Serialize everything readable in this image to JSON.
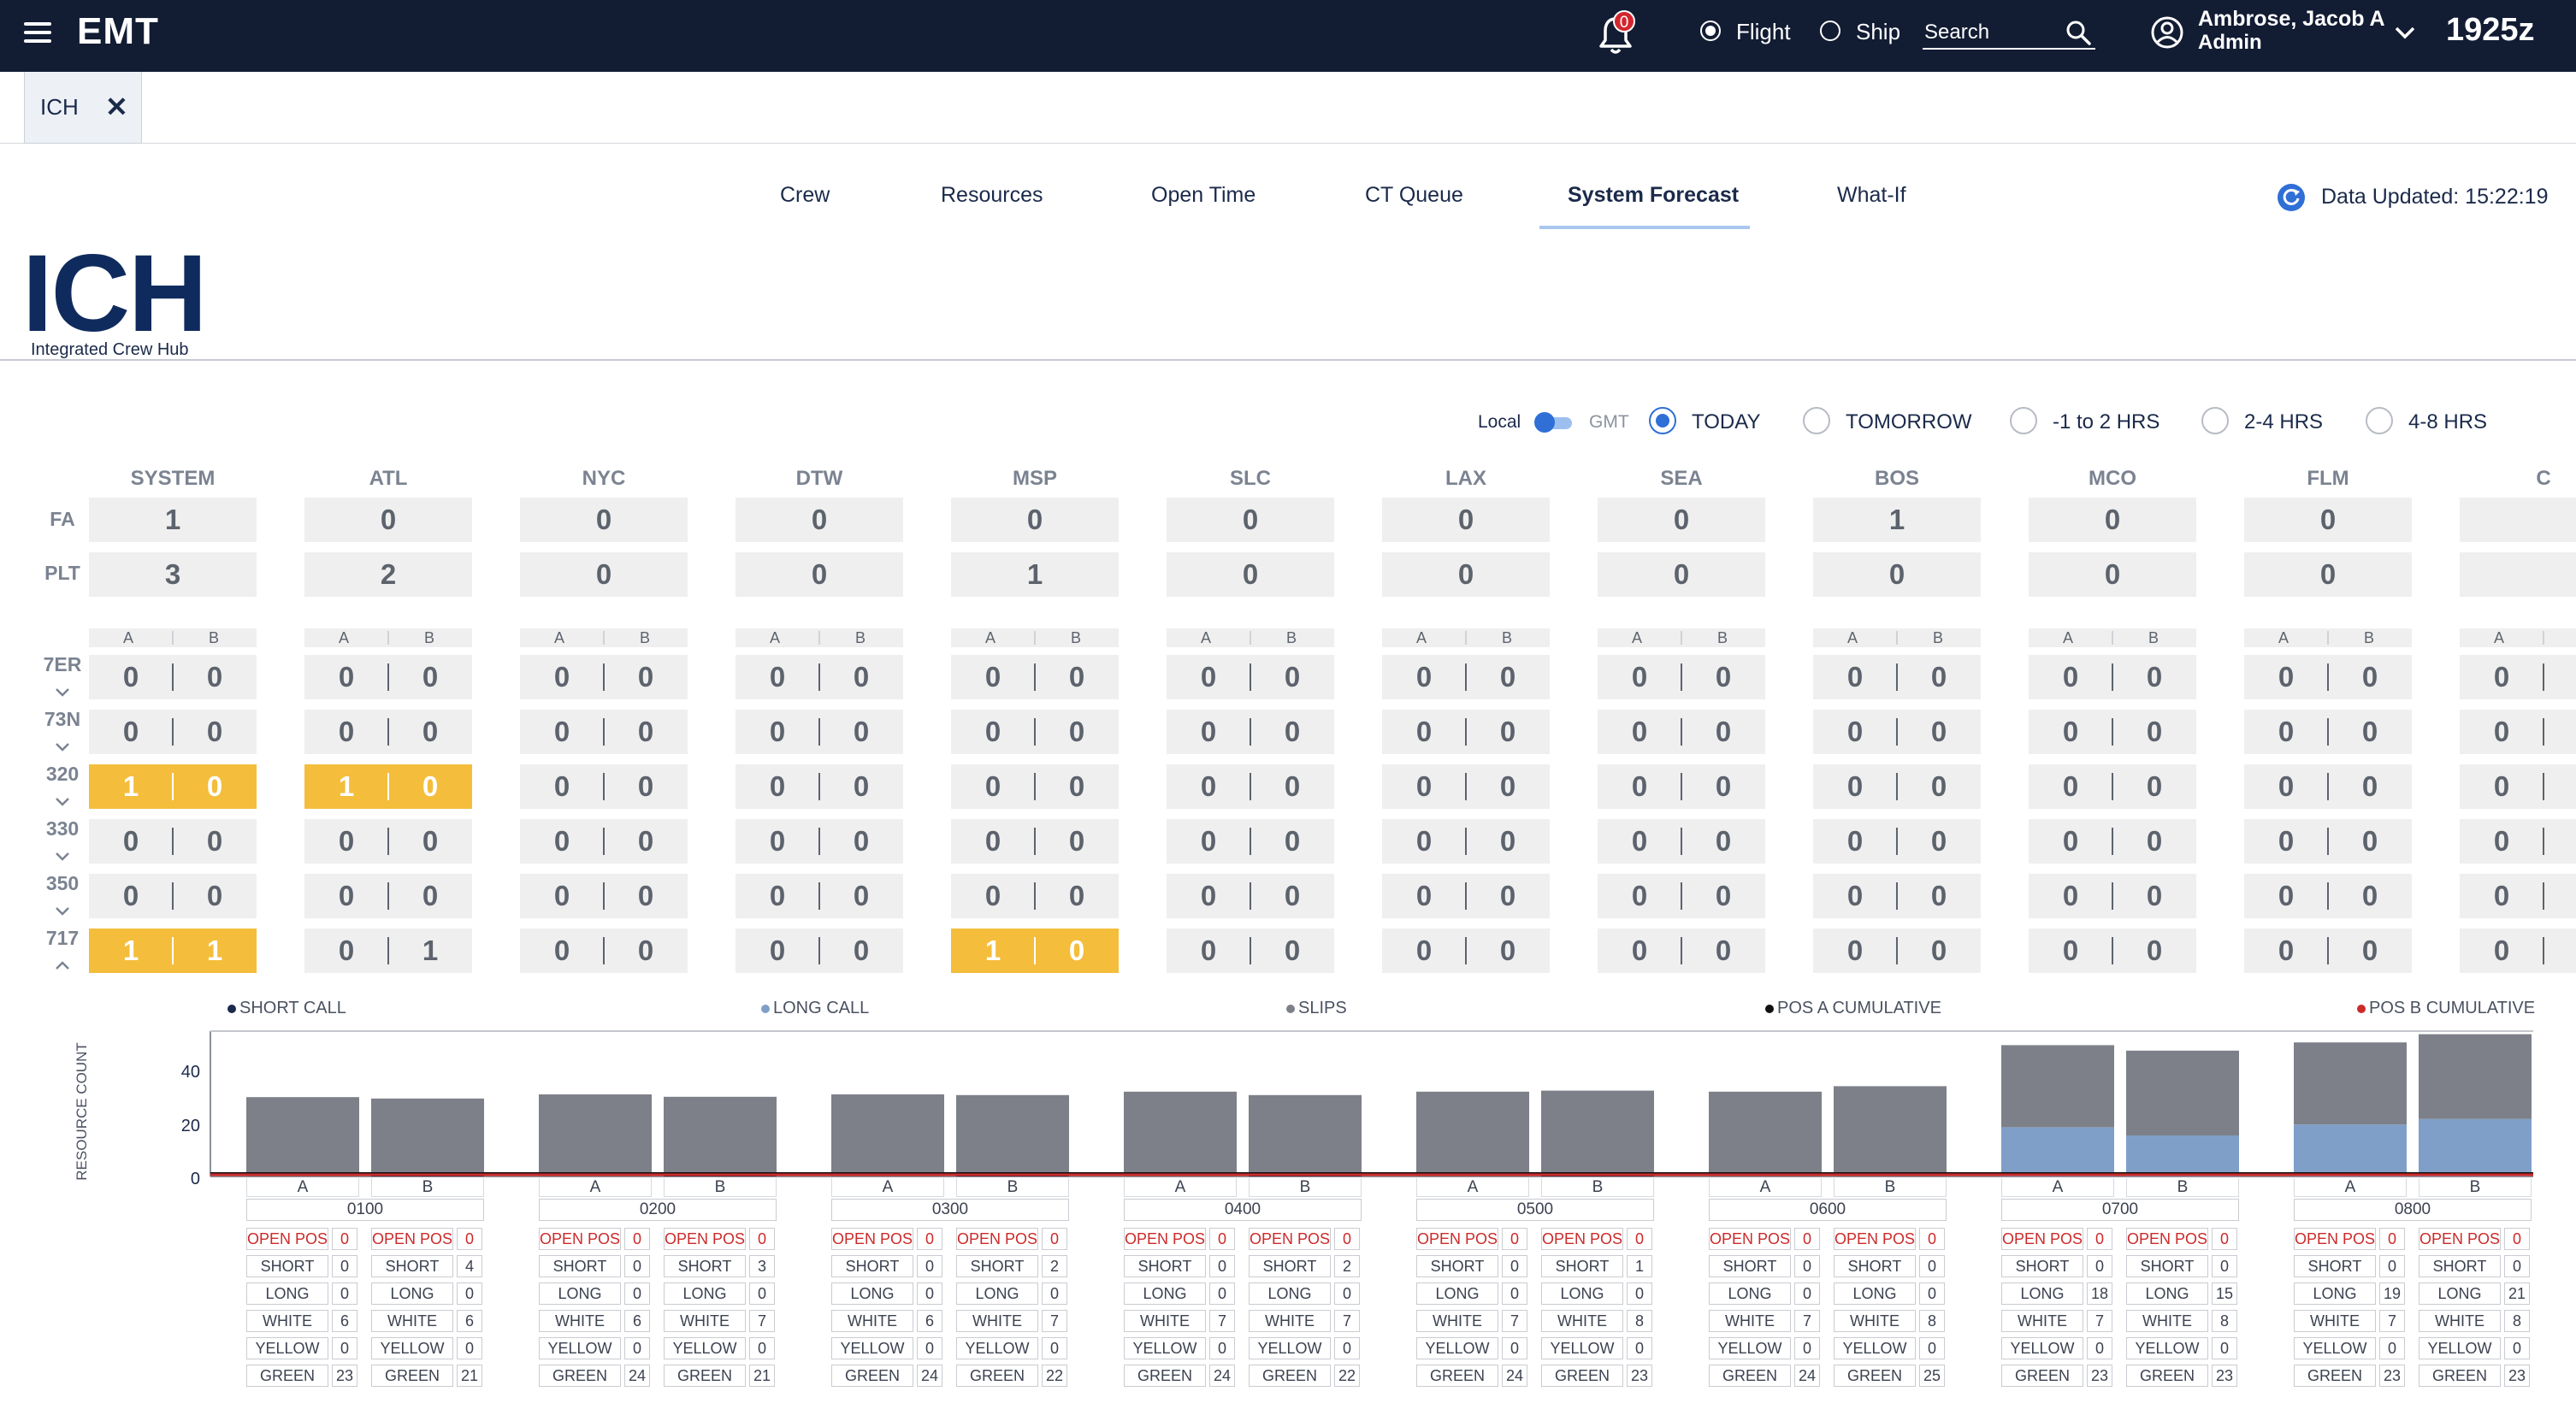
{
  "topbar": {
    "app_name": "EMT",
    "notification_count": "0",
    "mode_flight": "Flight",
    "mode_ship": "Ship",
    "search_placeholder": "Search",
    "user_name": "Ambrose, Jacob A",
    "user_role": "Admin",
    "zulu_time": "1925z"
  },
  "open_tab": {
    "label": "ICH",
    "close": "✕"
  },
  "nav": {
    "tabs": [
      "Crew",
      "Resources",
      "Open Time",
      "CT Queue",
      "System Forecast",
      "What-If"
    ],
    "active": "System Forecast",
    "data_updated": "Data Updated: 15:22:19"
  },
  "logo": {
    "title": "ICH",
    "subtitle": "Integrated Crew Hub"
  },
  "filters": {
    "tz_local": "Local",
    "tz_gmt": "GMT",
    "ranges": [
      "TODAY",
      "TOMORROW",
      "-1 to 2 HRS",
      "2-4 HRS",
      "4-8 HRS"
    ],
    "selected": "TODAY"
  },
  "grid": {
    "row_labels": {
      "fa": "FA",
      "plt": "PLT"
    },
    "ab_labels": [
      "A",
      "B"
    ],
    "fleets": [
      "7ER",
      "73N",
      "320",
      "330",
      "350",
      "717"
    ],
    "stations": [
      {
        "name": "SYSTEM",
        "fa": "1",
        "plt": "3",
        "fleets": [
          [
            "0",
            "0"
          ],
          [
            "0",
            "0"
          ],
          [
            "1",
            "0"
          ],
          [
            "0",
            "0"
          ],
          [
            "0",
            "0"
          ],
          [
            "1",
            "1"
          ]
        ],
        "highlight": [
          2,
          5
        ]
      },
      {
        "name": "ATL",
        "fa": "0",
        "plt": "2",
        "fleets": [
          [
            "0",
            "0"
          ],
          [
            "0",
            "0"
          ],
          [
            "1",
            "0"
          ],
          [
            "0",
            "0"
          ],
          [
            "0",
            "0"
          ],
          [
            "0",
            "1"
          ]
        ],
        "highlight": [
          2
        ]
      },
      {
        "name": "NYC",
        "fa": "0",
        "plt": "0",
        "fleets": [
          [
            "0",
            "0"
          ],
          [
            "0",
            "0"
          ],
          [
            "0",
            "0"
          ],
          [
            "0",
            "0"
          ],
          [
            "0",
            "0"
          ],
          [
            "0",
            "0"
          ]
        ],
        "highlight": []
      },
      {
        "name": "DTW",
        "fa": "0",
        "plt": "0",
        "fleets": [
          [
            "0",
            "0"
          ],
          [
            "0",
            "0"
          ],
          [
            "0",
            "0"
          ],
          [
            "0",
            "0"
          ],
          [
            "0",
            "0"
          ],
          [
            "0",
            "0"
          ]
        ],
        "highlight": []
      },
      {
        "name": "MSP",
        "fa": "0",
        "plt": "1",
        "fleets": [
          [
            "0",
            "0"
          ],
          [
            "0",
            "0"
          ],
          [
            "0",
            "0"
          ],
          [
            "0",
            "0"
          ],
          [
            "0",
            "0"
          ],
          [
            "1",
            "0"
          ]
        ],
        "highlight": [
          5
        ]
      },
      {
        "name": "SLC",
        "fa": "0",
        "plt": "0",
        "fleets": [
          [
            "0",
            "0"
          ],
          [
            "0",
            "0"
          ],
          [
            "0",
            "0"
          ],
          [
            "0",
            "0"
          ],
          [
            "0",
            "0"
          ],
          [
            "0",
            "0"
          ]
        ],
        "highlight": []
      },
      {
        "name": "LAX",
        "fa": "0",
        "plt": "0",
        "fleets": [
          [
            "0",
            "0"
          ],
          [
            "0",
            "0"
          ],
          [
            "0",
            "0"
          ],
          [
            "0",
            "0"
          ],
          [
            "0",
            "0"
          ],
          [
            "0",
            "0"
          ]
        ],
        "highlight": []
      },
      {
        "name": "SEA",
        "fa": "0",
        "plt": "0",
        "fleets": [
          [
            "0",
            "0"
          ],
          [
            "0",
            "0"
          ],
          [
            "0",
            "0"
          ],
          [
            "0",
            "0"
          ],
          [
            "0",
            "0"
          ],
          [
            "0",
            "0"
          ]
        ],
        "highlight": []
      },
      {
        "name": "BOS",
        "fa": "1",
        "plt": "0",
        "fleets": [
          [
            "0",
            "0"
          ],
          [
            "0",
            "0"
          ],
          [
            "0",
            "0"
          ],
          [
            "0",
            "0"
          ],
          [
            "0",
            "0"
          ],
          [
            "0",
            "0"
          ]
        ],
        "highlight": []
      },
      {
        "name": "MCO",
        "fa": "0",
        "plt": "0",
        "fleets": [
          [
            "0",
            "0"
          ],
          [
            "0",
            "0"
          ],
          [
            "0",
            "0"
          ],
          [
            "0",
            "0"
          ],
          [
            "0",
            "0"
          ],
          [
            "0",
            "0"
          ]
        ],
        "highlight": []
      },
      {
        "name": "FLM",
        "fa": "0",
        "plt": "0",
        "fleets": [
          [
            "0",
            "0"
          ],
          [
            "0",
            "0"
          ],
          [
            "0",
            "0"
          ],
          [
            "0",
            "0"
          ],
          [
            "0",
            "0"
          ],
          [
            "0",
            "0"
          ]
        ],
        "highlight": []
      },
      {
        "name": "C",
        "fa": "",
        "plt": "",
        "fleets": [
          [
            "0",
            ""
          ],
          [
            "0",
            ""
          ],
          [
            "0",
            ""
          ],
          [
            "0",
            ""
          ],
          [
            "0",
            ""
          ],
          [
            "0",
            ""
          ]
        ],
        "highlight": []
      }
    ]
  },
  "chart_data": {
    "type": "bar",
    "legend": [
      "SHORT CALL",
      "LONG CALL",
      "SLIPS",
      "POS A CUMULATIVE",
      "POS B CUMULATIVE"
    ],
    "legend_colors": [
      "#1b2a4a",
      "#7f9fc9",
      "#7d8088",
      "#111111",
      "#cc2a2a"
    ],
    "ylabel": "RESOURCE COUNT",
    "yticks": [
      0,
      20,
      40
    ],
    "ylim": [
      0,
      50
    ],
    "categories": [
      "0100",
      "0200",
      "0300",
      "0400",
      "0500",
      "0600",
      "0700",
      "0800"
    ],
    "positions": [
      "A",
      "B"
    ],
    "row_labels": [
      "OPEN POS",
      "SHORT",
      "LONG",
      "WHITE",
      "YELLOW",
      "GREEN"
    ],
    "slots": [
      {
        "A": [
          0,
          0,
          0,
          6,
          0,
          23
        ],
        "B": [
          0,
          4,
          0,
          6,
          0,
          21
        ]
      },
      {
        "A": [
          0,
          0,
          0,
          6,
          0,
          24
        ],
        "B": [
          0,
          3,
          0,
          7,
          0,
          21
        ]
      },
      {
        "A": [
          0,
          0,
          0,
          6,
          0,
          24
        ],
        "B": [
          0,
          2,
          0,
          7,
          0,
          22
        ]
      },
      {
        "A": [
          0,
          0,
          0,
          7,
          0,
          24
        ],
        "B": [
          0,
          2,
          0,
          7,
          0,
          22
        ]
      },
      {
        "A": [
          0,
          0,
          0,
          7,
          0,
          24
        ],
        "B": [
          0,
          1,
          0,
          8,
          0,
          23
        ]
      },
      {
        "A": [
          0,
          0,
          0,
          7,
          0,
          24
        ],
        "B": [
          0,
          0,
          0,
          8,
          0,
          25
        ]
      },
      {
        "A": [
          0,
          0,
          18,
          7,
          0,
          23
        ],
        "B": [
          0,
          0,
          15,
          8,
          0,
          23
        ]
      },
      {
        "A": [
          0,
          0,
          19,
          7,
          0,
          23
        ],
        "B": [
          0,
          0,
          21,
          8,
          0,
          23
        ]
      }
    ]
  }
}
